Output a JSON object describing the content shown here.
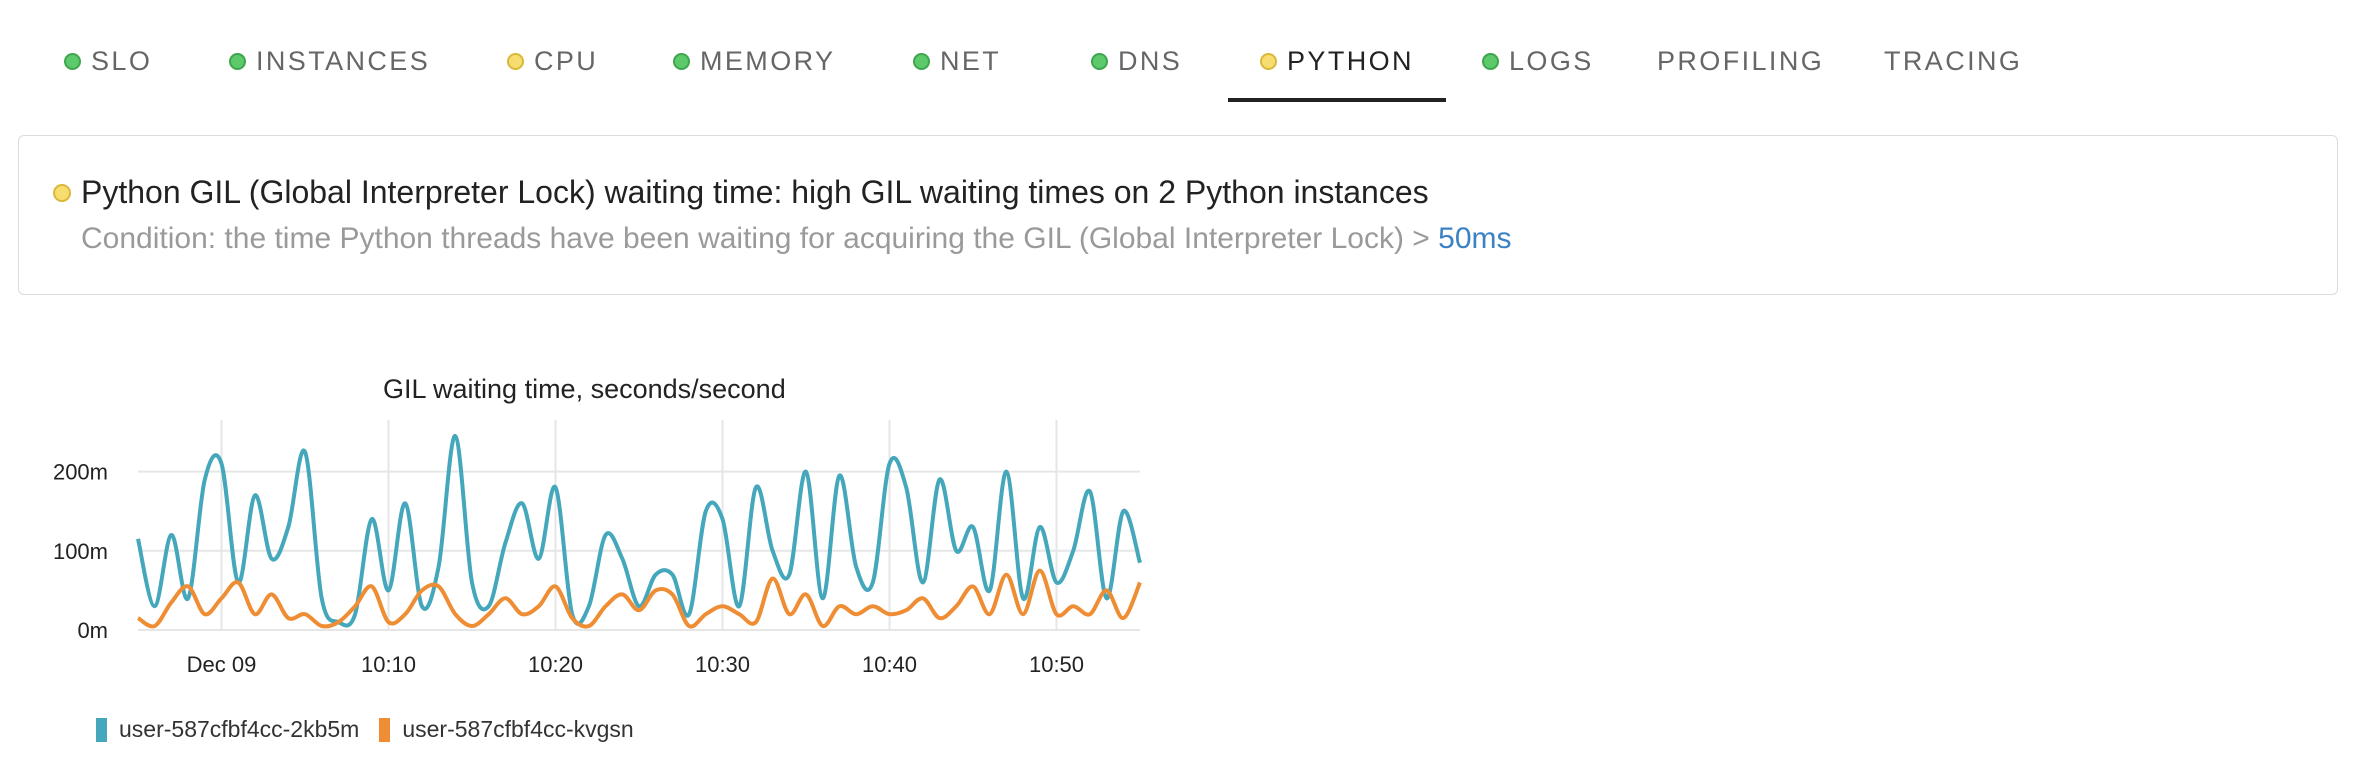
{
  "tabs": [
    {
      "label": "SLO",
      "status": "green"
    },
    {
      "label": "INSTANCES",
      "status": "green"
    },
    {
      "label": "CPU",
      "status": "yellow"
    },
    {
      "label": "MEMORY",
      "status": "green"
    },
    {
      "label": "NET",
      "status": "green"
    },
    {
      "label": "DNS",
      "status": "green"
    },
    {
      "label": "PYTHON",
      "status": "yellow",
      "active": true
    },
    {
      "label": "LOGS",
      "status": "green"
    },
    {
      "label": "PROFILING",
      "status": null
    },
    {
      "label": "TRACING",
      "status": null
    }
  ],
  "alert": {
    "status": "yellow",
    "title": "Python GIL (Global Interpreter Lock) waiting time: high GIL waiting times on 2 Python instances",
    "condition_prefix": "Condition: the time Python threads have been waiting for acquiring the GIL (Global Interpreter Lock) > ",
    "threshold": "50ms"
  },
  "colors": {
    "green": "#5cc96b",
    "yellow": "#f7dc6f",
    "series_1": "#44a7bb",
    "series_2": "#ee8d33",
    "threshold_link": "#3b82c4"
  },
  "chart_data": {
    "type": "line",
    "title": "GIL waiting time, seconds/second",
    "ylim": [
      0,
      0.25
    ],
    "y_ticks": [
      {
        "value": 0,
        "label": "0m"
      },
      {
        "value": 0.1,
        "label": "100m"
      },
      {
        "value": 0.2,
        "label": "200m"
      }
    ],
    "x_range": [
      "09:55",
      "10:55"
    ],
    "x_ticks": [
      {
        "time": "10:00",
        "label": "Dec 09"
      },
      {
        "time": "10:10",
        "label": "10:10"
      },
      {
        "time": "10:20",
        "label": "10:20"
      },
      {
        "time": "10:30",
        "label": "10:30"
      },
      {
        "time": "10:40",
        "label": "10:40"
      },
      {
        "time": "10:50",
        "label": "10:50"
      }
    ],
    "grid": true,
    "legend_position": "bottom-left",
    "series": [
      {
        "name": "user-587cfbf4cc-2kb5m",
        "color": "#44a7bb",
        "x": [
          "09:55",
          "09:56",
          "09:57",
          "09:58",
          "09:59",
          "10:00",
          "10:01",
          "10:02",
          "10:03",
          "10:04",
          "10:05",
          "10:06",
          "10:07",
          "10:08",
          "10:09",
          "10:10",
          "10:11",
          "10:12",
          "10:13",
          "10:14",
          "10:15",
          "10:16",
          "10:17",
          "10:18",
          "10:19",
          "10:20",
          "10:21",
          "10:22",
          "10:23",
          "10:24",
          "10:25",
          "10:26",
          "10:27",
          "10:28",
          "10:29",
          "10:30",
          "10:31",
          "10:32",
          "10:33",
          "10:34",
          "10:35",
          "10:36",
          "10:37",
          "10:38",
          "10:39",
          "10:40",
          "10:41",
          "10:42",
          "10:43",
          "10:44",
          "10:45",
          "10:46",
          "10:47",
          "10:48",
          "10:49",
          "10:50",
          "10:51",
          "10:52",
          "10:53",
          "10:54",
          "10:55"
        ],
        "values": [
          0.115,
          0.03,
          0.12,
          0.04,
          0.19,
          0.21,
          0.06,
          0.17,
          0.09,
          0.13,
          0.225,
          0.04,
          0.01,
          0.02,
          0.14,
          0.05,
          0.16,
          0.03,
          0.08,
          0.245,
          0.06,
          0.03,
          0.11,
          0.16,
          0.09,
          0.18,
          0.02,
          0.03,
          0.12,
          0.09,
          0.03,
          0.07,
          0.07,
          0.02,
          0.15,
          0.14,
          0.03,
          0.18,
          0.1,
          0.07,
          0.2,
          0.04,
          0.195,
          0.08,
          0.06,
          0.21,
          0.18,
          0.06,
          0.19,
          0.1,
          0.13,
          0.05,
          0.2,
          0.04,
          0.13,
          0.06,
          0.1,
          0.175,
          0.04,
          0.15,
          0.085
        ],
        "line_width_note": null
      },
      {
        "name": "user-587cfbf4cc-kvgsn",
        "color": "#ee8d33",
        "x": [
          "09:55",
          "09:56",
          "09:57",
          "09:58",
          "09:59",
          "10:00",
          "10:01",
          "10:02",
          "10:03",
          "10:04",
          "10:05",
          "10:06",
          "10:07",
          "10:08",
          "10:09",
          "10:10",
          "10:11",
          "10:12",
          "10:13",
          "10:14",
          "10:15",
          "10:16",
          "10:17",
          "10:18",
          "10:19",
          "10:20",
          "10:21",
          "10:22",
          "10:23",
          "10:24",
          "10:25",
          "10:26",
          "10:27",
          "10:28",
          "10:29",
          "10:30",
          "10:31",
          "10:32",
          "10:33",
          "10:34",
          "10:35",
          "10:36",
          "10:37",
          "10:38",
          "10:39",
          "10:40",
          "10:41",
          "10:42",
          "10:43",
          "10:44",
          "10:45",
          "10:46",
          "10:47",
          "10:48",
          "10:49",
          "10:50",
          "10:51",
          "10:52",
          "10:53",
          "10:54",
          "10:55"
        ],
        "values": [
          0.015,
          0.005,
          0.035,
          0.055,
          0.02,
          0.04,
          0.06,
          0.02,
          0.045,
          0.015,
          0.02,
          0.005,
          0.01,
          0.03,
          0.055,
          0.01,
          0.02,
          0.05,
          0.055,
          0.02,
          0.005,
          0.02,
          0.04,
          0.02,
          0.03,
          0.055,
          0.015,
          0.005,
          0.03,
          0.045,
          0.025,
          0.05,
          0.045,
          0.005,
          0.02,
          0.03,
          0.02,
          0.01,
          0.065,
          0.02,
          0.045,
          0.005,
          0.03,
          0.02,
          0.03,
          0.02,
          0.025,
          0.04,
          0.015,
          0.03,
          0.055,
          0.02,
          0.07,
          0.02,
          0.075,
          0.02,
          0.03,
          0.02,
          0.05,
          0.015,
          0.06
        ]
      }
    ]
  }
}
